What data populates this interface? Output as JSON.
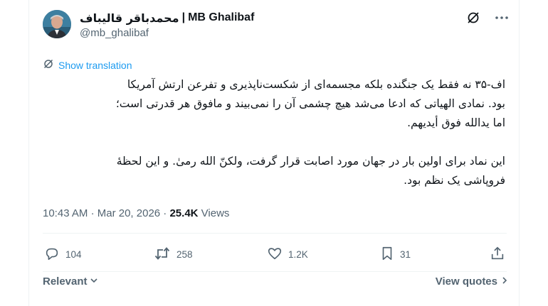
{
  "author": {
    "display_name": "محمدباقر قالیباف",
    "separator": "|",
    "latin_name": "MB Ghalibaf",
    "handle": "@mb_ghalibaf"
  },
  "translate": {
    "label": "Show translation"
  },
  "tweet": {
    "paragraph1_lines": [
      "اف-۳۵ نه فقط یک جنگنده بلکه مجسمه‌ای از شکست‌ناپذیری و تفرعن ارتش آمریکا",
      "بود. نمادی الهیاتی که ادعا می‌شد هیچ چشمی آن را نمی‌بیند و مافوق هر قدرتی است؛",
      "اما یدالله فوق أیدیهم."
    ],
    "paragraph2_lines": [
      "این نماد برای اولین بار در جهان مورد اصابت قرار گرفت، ولکنّ الله رمیٰ. و این لحظهٔ",
      "فروپاشی یک نظم بود."
    ]
  },
  "meta": {
    "time": "10:43 AM",
    "dot1": "·",
    "date": "Mar 20, 2026",
    "dot2": "·",
    "views_count": "25.4K",
    "views_label": "Views"
  },
  "actions": {
    "replies": "104",
    "reposts": "258",
    "likes": "1.2K",
    "bookmarks": "31"
  },
  "footer": {
    "sort_label": "Relevant",
    "view_quotes_label": "View quotes"
  },
  "colors": {
    "accent": "#1d9bf0",
    "muted": "#536471",
    "text": "#0f1419",
    "divider": "#eff3f4"
  },
  "icons": {
    "grok": "grok-icon",
    "more": "more-icon",
    "translate": "translate-icon",
    "reply": "reply-icon",
    "repost": "repost-icon",
    "like": "heart-icon",
    "bookmark": "bookmark-icon",
    "share": "share-icon"
  }
}
